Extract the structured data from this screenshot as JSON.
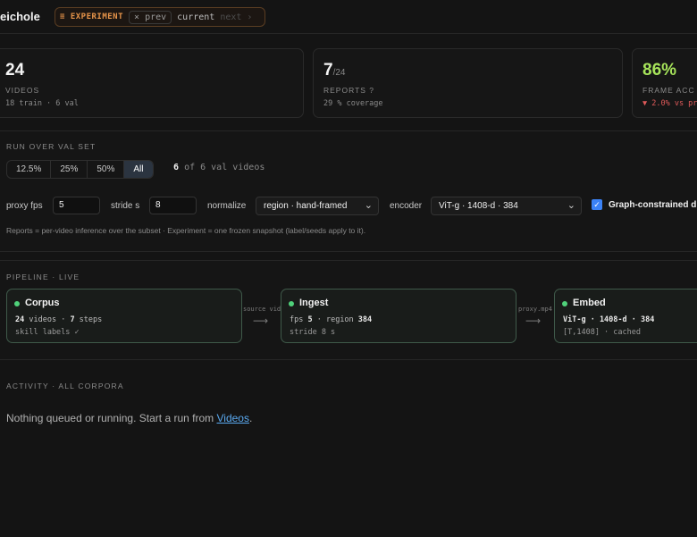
{
  "app": {
    "title": "eichole"
  },
  "experiment": {
    "tag": "≡ EXPERIMENT",
    "prev": "× prev",
    "current": "current",
    "next": "next ›"
  },
  "stats": [
    {
      "value": "24",
      "suffix": "",
      "label": "VIDEOS",
      "sub": "18 train · 6 val"
    },
    {
      "value": "7",
      "suffix": "/24",
      "label": "REPORTS ?",
      "sub": "29 % coverage"
    },
    {
      "value": "86%",
      "suffix": "",
      "label": "FRAME ACC",
      "sub": "▼ 2.0% vs pr"
    }
  ],
  "run": {
    "title": "RUN OVER VAL SET",
    "subset_options": [
      "12.5%",
      "25%",
      "50%",
      "All"
    ],
    "selected_subset": "All",
    "video_count_num": "6",
    "video_count_text": "of 6 val videos",
    "fields": {
      "proxy_fps_label": "proxy fps",
      "proxy_fps_value": "5",
      "stride_label": "stride s",
      "stride_value": "8",
      "normalize_label": "normalize",
      "normalize_value": "region · hand-framed",
      "encoder_label": "encoder",
      "encoder_value": "ViT-g · 1408-d · 384",
      "graph_label": "Graph-constrained d",
      "graph_checked": true
    },
    "note": "Reports = per-video inference over the subset · Experiment = one frozen snapshot (label/seeds apply to it)."
  },
  "pipeline": {
    "title": "PIPELINE · LIVE",
    "nodes": [
      {
        "title": "Corpus",
        "line1_a": "24",
        "line1_b": " videos · ",
        "line1_c": "7",
        "line1_d": " steps",
        "line2": "skill labels ✓"
      },
      {
        "title": "Ingest",
        "line1_a": "fps ",
        "line1_b": "5",
        "line1_c": " · region ",
        "line1_d": "384",
        "line2": "stride 8 s"
      },
      {
        "title": "Embed",
        "line1_a": "ViT-g · 1408-d · 384",
        "line1_b": "",
        "line1_c": "",
        "line1_d": "",
        "line2": "[T,1408] · cached"
      }
    ],
    "edges": [
      "source video",
      "proxy.mp4"
    ]
  },
  "activity": {
    "title": "ACTIVITY · ALL CORPORA",
    "empty_text": "Nothing queued or running. Start a run from ",
    "empty_link": "Videos",
    "empty_end": "."
  },
  "colors": {
    "accent_orange": "#e8954a",
    "accent_green": "#a6e35a",
    "status_green": "#4fd17a",
    "link_blue": "#5aa9f0",
    "negative_red": "#e05a5a"
  }
}
